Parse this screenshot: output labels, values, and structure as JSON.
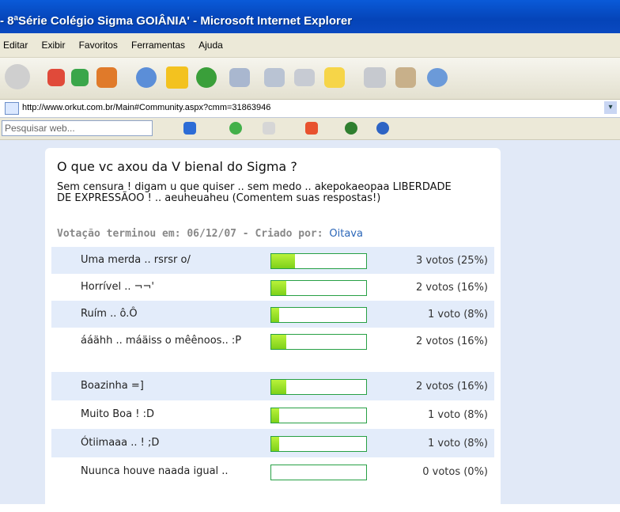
{
  "window": {
    "title": "- 8ªSérie Colégio Sigma GOIÂNIA' - Microsoft Internet Explorer"
  },
  "menu": [
    "Editar",
    "Exibir",
    "Favoritos",
    "Ferramentas",
    "Ajuda"
  ],
  "address": {
    "url": "http://www.orkut.com.br/Main#Community.aspx?cmm=31863946"
  },
  "search": {
    "placeholder": "Pesquisar web..."
  },
  "poll": {
    "title": "O que vc axou da V bienal do Sigma ?",
    "description": "Sem censura ! digam u que quiser .. sem medo .. akepokaeopaa LIBERDADE DE EXPRESSÃOO ! .. aeuheuaheu (Comentem suas respostas!)",
    "meta_label": "Votação terminou em: 06/12/07 - Criado por:",
    "creator": "Oitava",
    "options": [
      {
        "label": "Uma merda .. rsrsr o/",
        "votes": "3 votos (25%)",
        "pct": 25
      },
      {
        "label": "Horrível .. ¬¬'",
        "votes": "2 votos (16%)",
        "pct": 16
      },
      {
        "label": "Ruím .. ô.Ô",
        "votes": "1 voto (8%)",
        "pct": 8
      },
      {
        "label": "ááähh .. máäiss o mêênoos.. :P",
        "votes": "2 votos (16%)",
        "pct": 16
      },
      {
        "label": "Boazinha =]",
        "votes": "2 votos (16%)",
        "pct": 16
      },
      {
        "label": "Muito Boa ! :D",
        "votes": "1 voto (8%)",
        "pct": 8
      },
      {
        "label": "Ótiimaaa .. ! ;D",
        "votes": "1 voto (8%)",
        "pct": 8
      },
      {
        "label": "Nuunca houve naada igual ..",
        "votes": "0 votos (0%)",
        "pct": 0
      }
    ]
  },
  "colors": {
    "bar_fill": "#9be22b",
    "bar_border": "#27a045",
    "row_alt": "#e3ecfa",
    "link": "#2b66b8"
  },
  "toolbar_icons": [
    "back-icon",
    "forward-icon",
    "stop-icon",
    "refresh-icon",
    "home-icon",
    "search-icon",
    "favorites-icon",
    "history-icon",
    "mail-icon",
    "print-icon",
    "edit-icon",
    "notes-icon",
    "research-icon",
    "messenger-icon",
    "users-icon"
  ]
}
